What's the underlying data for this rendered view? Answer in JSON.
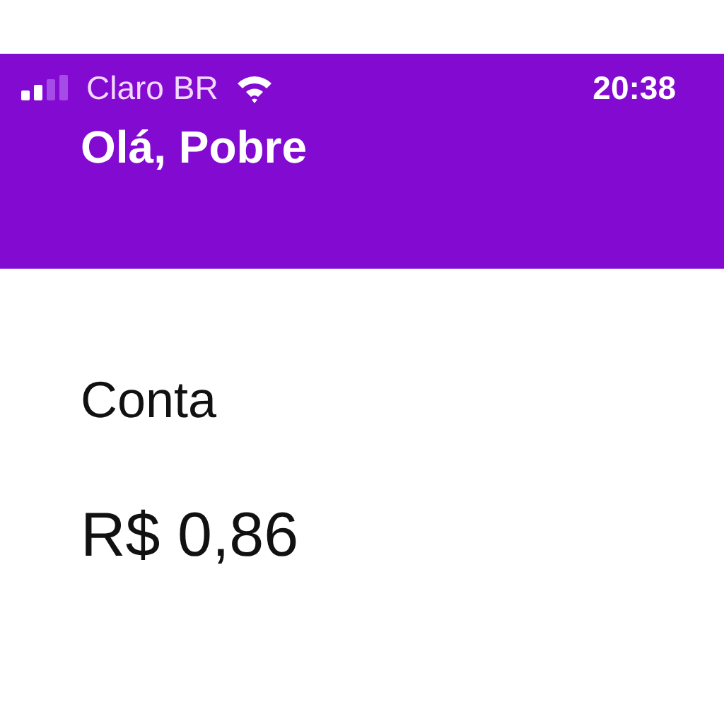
{
  "status_bar": {
    "carrier": "Claro BR",
    "time": "20:38"
  },
  "header": {
    "greeting": "Olá, Pobre"
  },
  "account": {
    "title": "Conta",
    "balance": "R$ 0,86"
  }
}
